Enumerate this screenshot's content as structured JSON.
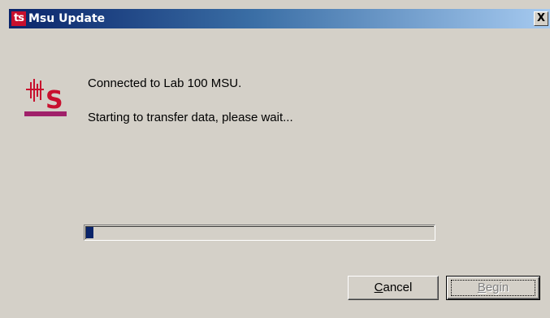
{
  "window": {
    "title": "Msu Update",
    "icon_text": "ts",
    "close_label": "X"
  },
  "logo": {
    "icon": "ts-seismic-logo-icon",
    "colors": {
      "red": "#c8102e",
      "purple": "#a0206a"
    }
  },
  "messages": {
    "line1": "Connected to Lab 100 MSU.",
    "line2": "Starting to transfer data, please wait..."
  },
  "progress": {
    "value_percent": 2
  },
  "buttons": {
    "cancel_access_key": "C",
    "cancel_rest": "ancel",
    "begin_access_key": "B",
    "begin_rest": "egin",
    "begin_enabled": false
  },
  "colors": {
    "dialog_bg": "#d4d0c8",
    "titlebar_start": "#0a246a",
    "titlebar_end": "#a6caf0",
    "progress_fill": "#0a246a"
  }
}
